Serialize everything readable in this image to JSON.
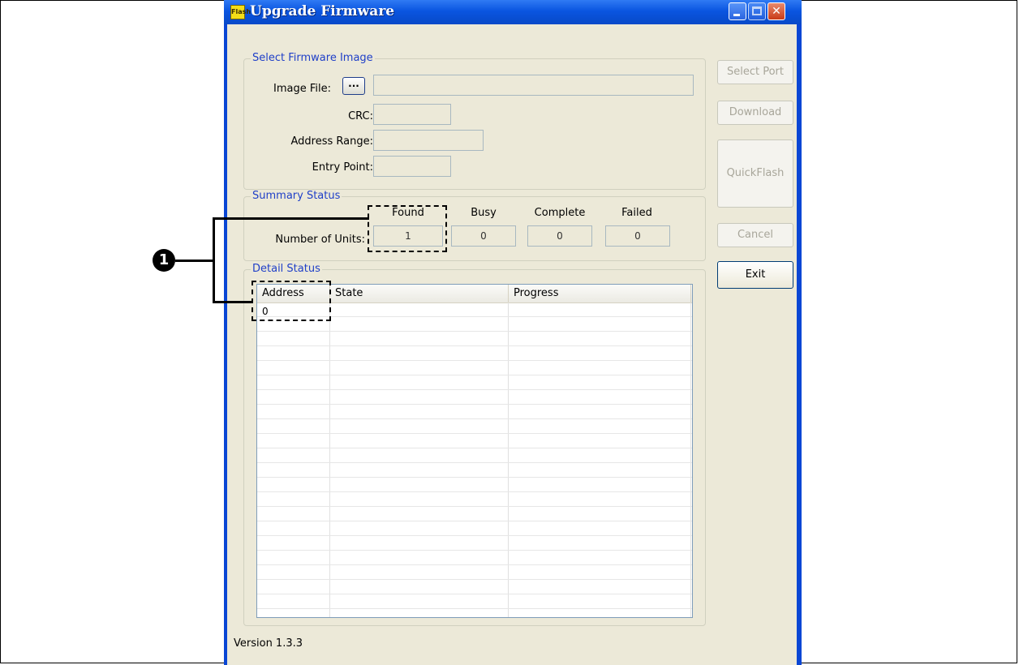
{
  "window": {
    "title": "Upgrade Firmware",
    "app_icon_text": "Flash"
  },
  "firmware_group": {
    "legend": "Select Firmware Image",
    "image_file_label": "Image File:",
    "browse_label": "...",
    "image_file_value": "",
    "crc_label": "CRC:",
    "crc_value": "",
    "address_range_label": "Address Range:",
    "address_range_value": "",
    "entry_point_label": "Entry Point:",
    "entry_point_value": ""
  },
  "summary_group": {
    "legend": "Summary Status",
    "headers": [
      "Found",
      "Busy",
      "Complete",
      "Failed"
    ],
    "row_label": "Number of Units:",
    "values": [
      "1",
      "0",
      "0",
      "0"
    ]
  },
  "detail_group": {
    "legend": "Detail Status",
    "columns": [
      "Address",
      "State",
      "Progress"
    ],
    "rows": [
      {
        "address": "0",
        "state": "",
        "progress": ""
      }
    ]
  },
  "side_buttons": {
    "select_port": "Select Port",
    "download": "Download",
    "quickflash": "QuickFlash",
    "cancel": "Cancel",
    "exit": "Exit"
  },
  "footer": {
    "version": "Version 1.3.3"
  },
  "annotation": {
    "marker": "1"
  }
}
